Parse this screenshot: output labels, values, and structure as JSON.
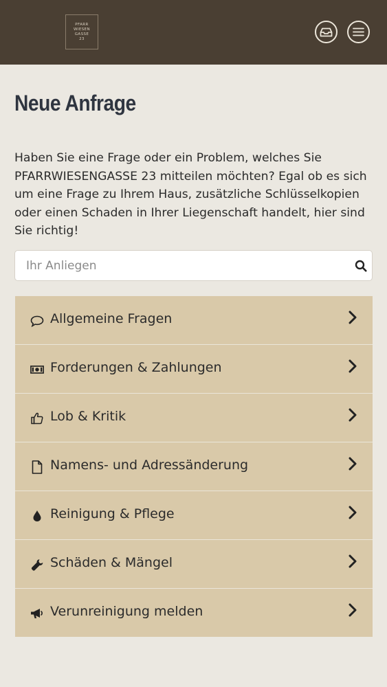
{
  "header": {
    "logo_lines": [
      "PFARR",
      "WIESEN",
      "GASSE",
      "23"
    ],
    "inbox_icon": "inbox-icon",
    "menu_icon": "hamburger-menu-icon"
  },
  "page": {
    "title": "Neue Anfrage",
    "intro": "Haben Sie eine Frage oder ein Problem, welches Sie PFARRWIESENGASSE 23 mitteilen möchten? Egal ob es sich um eine Frage zu Ihrem Haus, zusätzliche Schlüsselkopien oder einen Schaden in Ihrer Liegenschaft handelt, hier sind Sie richtig!"
  },
  "search": {
    "placeholder": "Ihr Anliegen",
    "value": "",
    "icon": "search-icon"
  },
  "categories": [
    {
      "label": "Allgemeine Fragen",
      "icon": "speech-bubble-icon"
    },
    {
      "label": "Forderungen & Zahlungen",
      "icon": "banknote-icon"
    },
    {
      "label": "Lob & Kritik",
      "icon": "thumbs-up-icon"
    },
    {
      "label": "Namens- und Adressänderung",
      "icon": "document-icon"
    },
    {
      "label": "Reinigung & Pflege",
      "icon": "water-drop-icon"
    },
    {
      "label": "Schäden & Mängel",
      "icon": "wrench-icon"
    },
    {
      "label": "Verunreinigung melden",
      "icon": "megaphone-icon"
    }
  ],
  "colors": {
    "header_bg": "#4a3f33",
    "page_bg": "#ebe8e1",
    "category_bg": "#d9c9a9",
    "title": "#2f3540"
  }
}
